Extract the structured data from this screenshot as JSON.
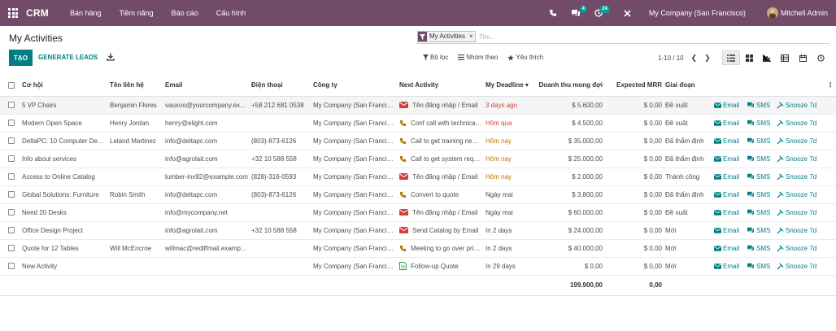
{
  "navbar": {
    "app": "CRM",
    "menus": [
      "Bán hàng",
      "Tiềm năng",
      "Báo cáo",
      "Cấu hình"
    ],
    "chat_badge": "4",
    "activity_badge": "24",
    "company": "My Company (San Francisco)",
    "user": "Mitchell Admin"
  },
  "control": {
    "title": "My Activities",
    "facet": "My Activities",
    "facet_close": "×",
    "search_placeholder": "Tìm...",
    "create_label": "TẠO",
    "generate_leads_label": "GENERATE LEADS",
    "filter_label": "Bộ lọc",
    "group_label": "Nhóm theo",
    "favorite_label": "Yêu thích",
    "pager": "1-10 / 10"
  },
  "colors": {
    "navbar": "#714b67",
    "primary": "#017e84",
    "late": "#d23f3a",
    "today": "#b47800"
  },
  "table": {
    "headers": [
      "Cơ hội",
      "Tên liên hệ",
      "Email",
      "Điện thoại",
      "Công ty",
      "Next Activity",
      "My Deadline",
      "Doanh thu mong đợi",
      "Expected MRR",
      "Giai đoạn"
    ],
    "row_actions": [
      "Email",
      "SMS",
      "Snooze 7d"
    ],
    "rows": [
      {
        "name": "5 VP Chairs",
        "contact": "Benjamin Flores",
        "email": "vauxoo@yourcompany.example.com",
        "phone": "+58 212 681 0538",
        "company": "My Company (San Francisco)",
        "activity": "Tên đăng nhập / Email",
        "activity_icon": "email",
        "deadline": "3 days ago",
        "deadline_state": "late",
        "revenue": "$ 5.600,00",
        "mrr": "$ 0,00",
        "stage": "Đề xuất"
      },
      {
        "name": "Modern Open Space",
        "contact": "Henry Jordan",
        "email": "henry@elight.com",
        "phone": "",
        "company": "My Company (San Francisco)",
        "activity": "Conf call with technical service",
        "activity_icon": "phone",
        "deadline": "Hôm qua",
        "deadline_state": "late",
        "revenue": "$ 4.500,00",
        "mrr": "$ 0,00",
        "stage": "Đề xuất"
      },
      {
        "name": "DeltaPC: 10 Computer Desks",
        "contact": "Leland Martinez",
        "email": "info@deltapc.com",
        "phone": "(803)-873-6126",
        "company": "My Company (San Francisco)",
        "activity": "Call to get training needs",
        "activity_icon": "phone",
        "deadline": "Hôm nay",
        "deadline_state": "today",
        "revenue": "$ 35.000,00",
        "mrr": "$ 0,00",
        "stage": "Đã thẩm định"
      },
      {
        "name": "Info about services",
        "contact": "",
        "email": "info@agrolait.com",
        "phone": "+32 10 588 558",
        "company": "My Company (San Francisco)",
        "activity": "Call to get system requirements",
        "activity_icon": "phone",
        "deadline": "Hôm nay",
        "deadline_state": "today",
        "revenue": "$ 25.000,00",
        "mrr": "$ 0,00",
        "stage": "Đã thẩm định"
      },
      {
        "name": "Access to Online Catalog",
        "contact": "",
        "email": "lumber-inv92@example.com",
        "phone": "(828)-316-0593",
        "company": "My Company (San Francisco)",
        "activity": "Tên đăng nhập / Email",
        "activity_icon": "email",
        "deadline": "Hôm nay",
        "deadline_state": "today",
        "revenue": "$ 2.000,00",
        "mrr": "$ 0,00",
        "stage": "Thành công"
      },
      {
        "name": "Global Solutions: Furniture",
        "contact": "Robin Smith",
        "email": "info@deltapc.com",
        "phone": "(803)-873-6126",
        "company": "My Company (San Francisco)",
        "activity": "Convert to quote",
        "activity_icon": "phone",
        "deadline": "Ngày mai",
        "deadline_state": "future",
        "revenue": "$ 3.800,00",
        "mrr": "$ 0,00",
        "stage": "Đã thẩm định"
      },
      {
        "name": "Need 20 Desks",
        "contact": "",
        "email": "info@mycompany.net",
        "phone": "",
        "company": "My Company (San Francisco)",
        "activity": "Tên đăng nhập / Email",
        "activity_icon": "email",
        "deadline": "Ngày mai",
        "deadline_state": "future",
        "revenue": "$ 60.000,00",
        "mrr": "$ 0,00",
        "stage": "Đề xuất"
      },
      {
        "name": "Office Design Project",
        "contact": "",
        "email": "info@agrolait.com",
        "phone": "+32 10 588 558",
        "company": "My Company (San Francisco)",
        "activity": "Send Catalog by Email",
        "activity_icon": "email",
        "deadline": "In 2 days",
        "deadline_state": "future",
        "revenue": "$ 24.000,00",
        "mrr": "$ 0,00",
        "stage": "Mới"
      },
      {
        "name": "Quote for 12 Tables",
        "contact": "Will McEncroe",
        "email": "willmac@rediffmail.example.com",
        "phone": "",
        "company": "My Company (San Francisco)",
        "activity": "Meeting to go over pricing",
        "activity_icon": "phone",
        "deadline": "In 2 days",
        "deadline_state": "future",
        "revenue": "$ 40.000,00",
        "mrr": "$ 0,00",
        "stage": "Mới"
      },
      {
        "name": "New Activity",
        "contact": "",
        "email": "",
        "phone": "",
        "company": "My Company (San Francisco)",
        "activity": "Follow-up Quote",
        "activity_icon": "doc",
        "deadline": "In 29 days",
        "deadline_state": "future",
        "revenue": "$ 0,00",
        "mrr": "$ 0,00",
        "stage": "Mới"
      }
    ],
    "total_revenue": "199.900,00",
    "total_mrr": "0,00"
  }
}
